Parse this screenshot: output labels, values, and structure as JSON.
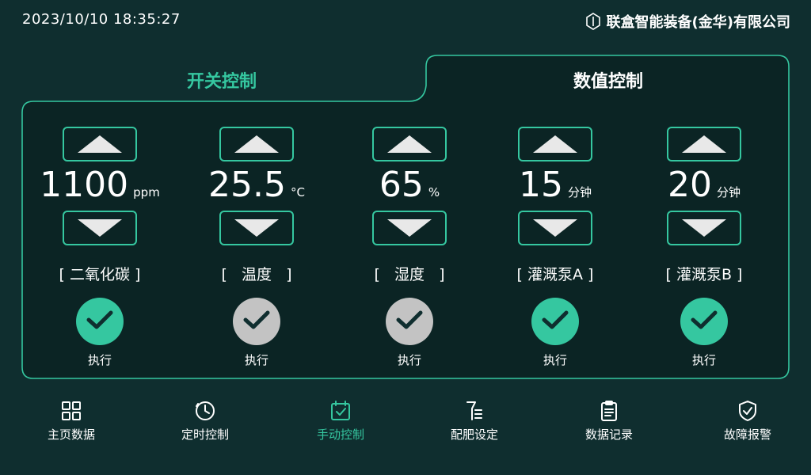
{
  "header": {
    "datetime": "2023/10/10  18:35:27",
    "company": "联盒智能装备(金华)有限公司",
    "logo_icon": "hexagon-logo-icon"
  },
  "tabs": [
    {
      "label": "开关控制",
      "active": false
    },
    {
      "label": "数值控制",
      "active": true
    }
  ],
  "controls": [
    {
      "value": "1100",
      "unit": "ppm",
      "label": "[ 二氧化碳 ]",
      "exec_label": "执行",
      "enabled": true
    },
    {
      "value": "25.5",
      "unit": "°C",
      "label": "[   温度   ]",
      "exec_label": "执行",
      "enabled": false
    },
    {
      "value": "65",
      "unit": "%",
      "label": "[   湿度   ]",
      "exec_label": "执行",
      "enabled": false
    },
    {
      "value": "15",
      "unit": "分钟",
      "label": "[ 灌溉泵A ]",
      "exec_label": "执行",
      "enabled": true
    },
    {
      "value": "20",
      "unit": "分钟",
      "label": "[ 灌溉泵B ]",
      "exec_label": "执行",
      "enabled": true
    }
  ],
  "nav": [
    {
      "label": "主页数据",
      "icon": "grid-icon",
      "active": false
    },
    {
      "label": "定时控制",
      "icon": "clock-icon",
      "active": false
    },
    {
      "label": "手动控制",
      "icon": "calendar-check-icon",
      "active": true
    },
    {
      "label": "配肥设定",
      "icon": "fertilizer-icon",
      "active": false
    },
    {
      "label": "数据记录",
      "icon": "clipboard-icon",
      "active": false
    },
    {
      "label": "故障报警",
      "icon": "shield-check-icon",
      "active": false
    }
  ],
  "colors": {
    "background": "#0f2e2f",
    "panel": "#0b2424",
    "accent": "#35c7a0",
    "disabled": "#c3c3c3"
  }
}
